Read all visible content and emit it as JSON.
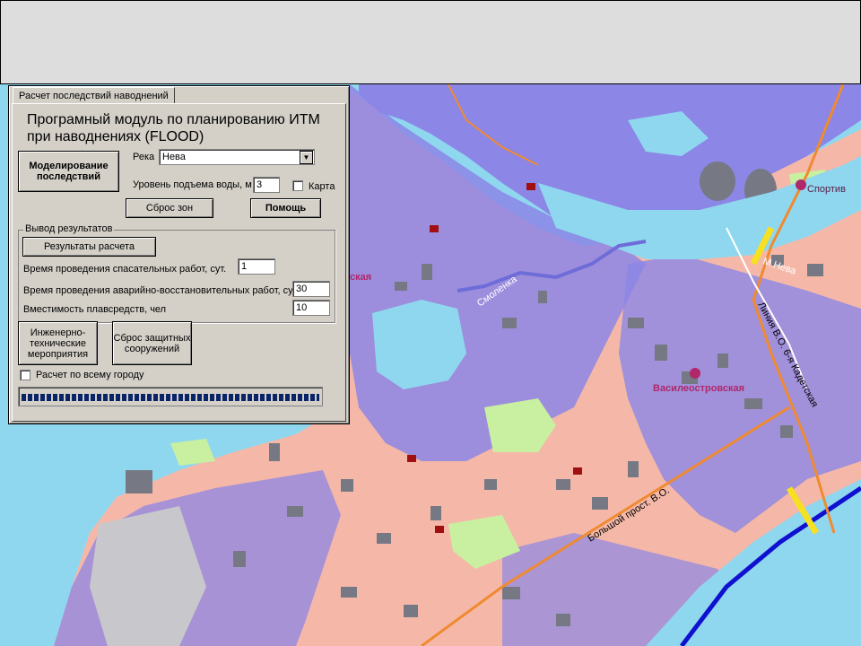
{
  "panel": {
    "tab_label": "Расчет последствий наводнений",
    "title": "Програмный модуль по планированию ИТМ при наводнениях (FLOOD)",
    "model_button": "Моделирование последствий",
    "river_label": "Река",
    "river_value": "Нева",
    "water_level_label": "Уровень подъема воды, м",
    "water_level_value": "3",
    "map_checkbox_label": "Карта",
    "reset_zones_button": "Сброс зон",
    "help_button": "Помощь",
    "output_group_title": "Вывод результатов",
    "results_button": "Результаты расчета",
    "rescue_time_label": "Время проведения спасательных работ, сут.",
    "rescue_time_value": "1",
    "restore_time_label": "Время проведения аварийно-восстановительных работ, сут.",
    "restore_time_value": "30",
    "capacity_label": "Вместимость плавсредств, чел",
    "capacity_value": "10",
    "engineering_button": "Инженерно-технические мероприятия",
    "reset_protect_button": "Сброс защитных сооружений",
    "whole_city_label": "Расчет по всему городу",
    "progress": 1.0
  },
  "map": {
    "labels": {
      "neva": "М.Нева",
      "sport": "Спортив",
      "vasileostr": "Василеостровская",
      "line": "Линия В.О. 6-я Кадетская",
      "bolshoy": "Большой прост. В.О.",
      "smolenka": "Смоленка",
      "sk": "ская"
    },
    "colors": {
      "water": "#8fd7ef",
      "flood": "#8c86e6",
      "flood_dark": "#6e6cd8",
      "blocks": "#f5b8a8",
      "buildings": "#767884",
      "green": "#c8f0a0",
      "road": "#f08a30",
      "bridge": "#f6e020",
      "metro": "#b0286a"
    }
  }
}
